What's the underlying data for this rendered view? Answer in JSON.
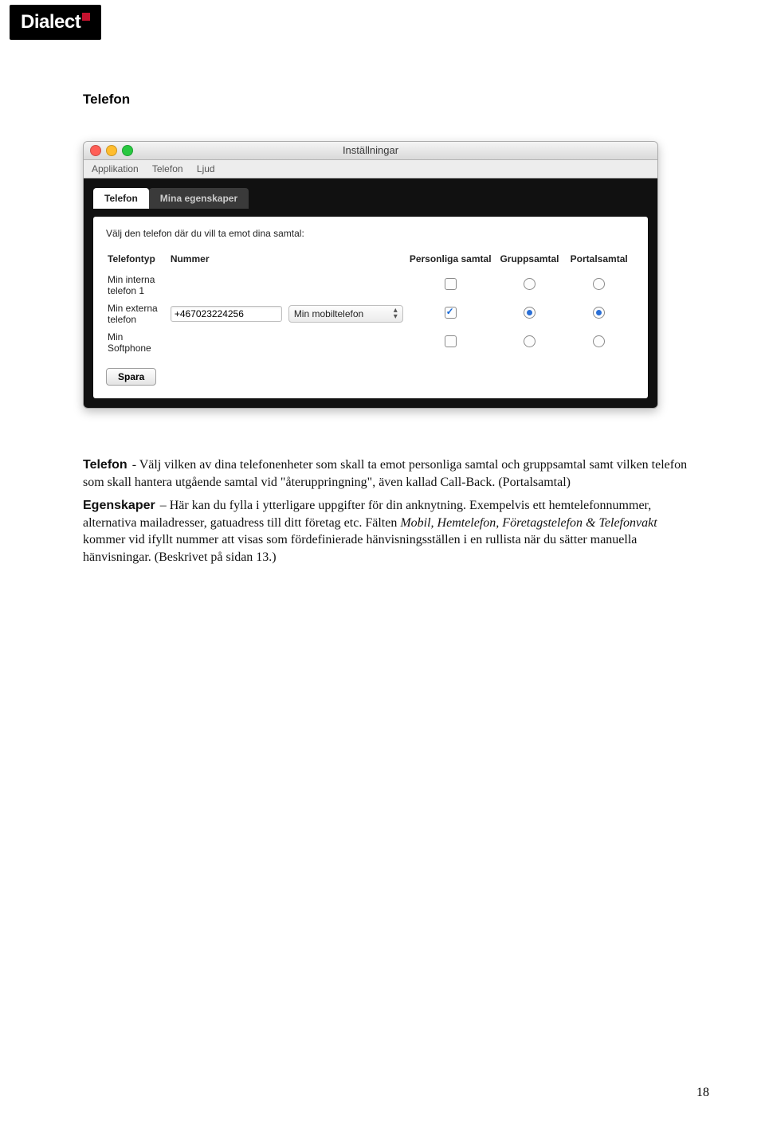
{
  "logo": {
    "text": "Dialect"
  },
  "heading": "Telefon",
  "window": {
    "title": "Inställningar",
    "menus": [
      "Applikation",
      "Telefon",
      "Ljud"
    ],
    "tabs": [
      {
        "label": "Telefon",
        "active": true
      },
      {
        "label": "Mina egenskaper",
        "active": false
      }
    ],
    "instruction": "Välj den telefon där du vill ta emot dina samtal:",
    "columns": {
      "telefontyp": "Telefontyp",
      "nummer": "Nummer",
      "personliga": "Personliga samtal",
      "grupp": "Gruppsamtal",
      "portal": "Portalsamtal"
    },
    "rows": [
      {
        "label": "Min interna telefon 1",
        "number": "",
        "select": "",
        "personliga": "unchecked",
        "grupp": "radio",
        "portal": "radio"
      },
      {
        "label": "Min externa telefon",
        "number": "+467023224256",
        "select": "Min mobiltelefon",
        "personliga": "checked",
        "grupp": "radio-selected",
        "portal": "radio-selected"
      },
      {
        "label": "Min Softphone",
        "number": "",
        "select": "",
        "personliga": "unchecked",
        "grupp": "radio",
        "portal": "radio"
      }
    ],
    "save": "Spara"
  },
  "paragraphs": {
    "p1_lead": "Telefon",
    "p1_rest": " - Välj vilken av dina telefonenheter som skall ta emot personliga samtal och gruppsamtal samt vilken telefon som skall hantera utgående samtal vid \"återuppringning\", även kallad Call-Back. (Portalsamtal)",
    "p2_lead": "Egenskaper",
    "p2_rest_a": " – Här kan du fylla i ytterligare uppgifter för din anknytning. Exempelvis ett hemtelefonnummer, alternativa mailadresser, gatuadress till ditt företag etc. Fälten ",
    "p2_ital": "Mobil, Hemtelefon, Företagstelefon & Telefonvakt",
    "p2_rest_b": " kommer vid ifyllt nummer att visas som fördefinierade hänvisningsställen i en rullista när du sätter manuella hänvisningar. (Beskrivet på sidan 13.)"
  },
  "page_number": "18"
}
